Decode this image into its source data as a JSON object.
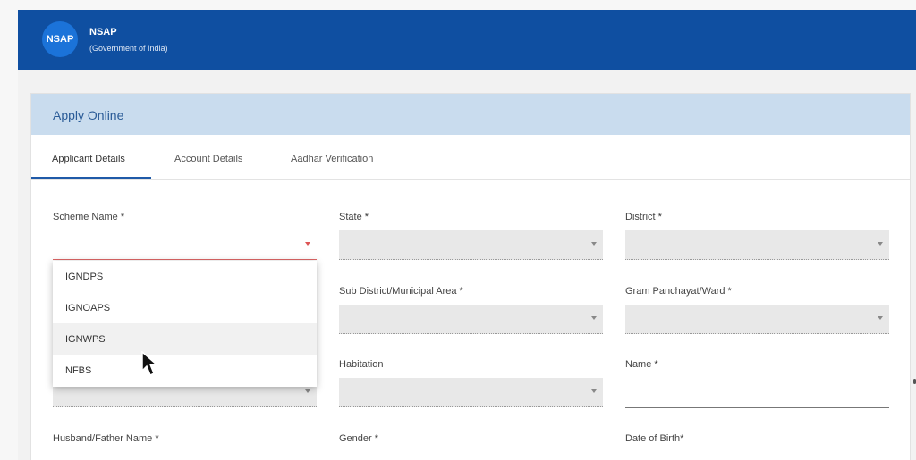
{
  "header": {
    "logo_text": "NSAP",
    "title": "NSAP",
    "subtitle": "(Government of India)",
    "color": "#0f4fa1"
  },
  "card": {
    "title": "Apply Online"
  },
  "tabs": [
    {
      "label": "Applicant Details",
      "active": true
    },
    {
      "label": "Account Details",
      "active": false
    },
    {
      "label": "Aadhar Verification",
      "active": false
    }
  ],
  "form": {
    "scheme_name": {
      "label": "Scheme Name",
      "required": "*"
    },
    "state": {
      "label": "State",
      "required": "*"
    },
    "district": {
      "label": "District",
      "required": "*"
    },
    "sub_district": {
      "label": "Sub District/Municipal Area",
      "required": "*"
    },
    "gram_panchayat": {
      "label": "Gram Panchayat/Ward",
      "required": "*"
    },
    "habitation": {
      "label": "Habitation"
    },
    "name": {
      "label": "Name",
      "required": "*"
    },
    "husband_father": {
      "label": "Husband/Father Name",
      "required": "*"
    },
    "gender": {
      "label": "Gender",
      "required": "*"
    },
    "dob": {
      "label": "Date of Birth*"
    }
  },
  "dropdown": {
    "options": [
      "IGNDPS",
      "IGNOAPS",
      "IGNWPS",
      "NFBS"
    ],
    "hovered": "IGNWPS"
  }
}
